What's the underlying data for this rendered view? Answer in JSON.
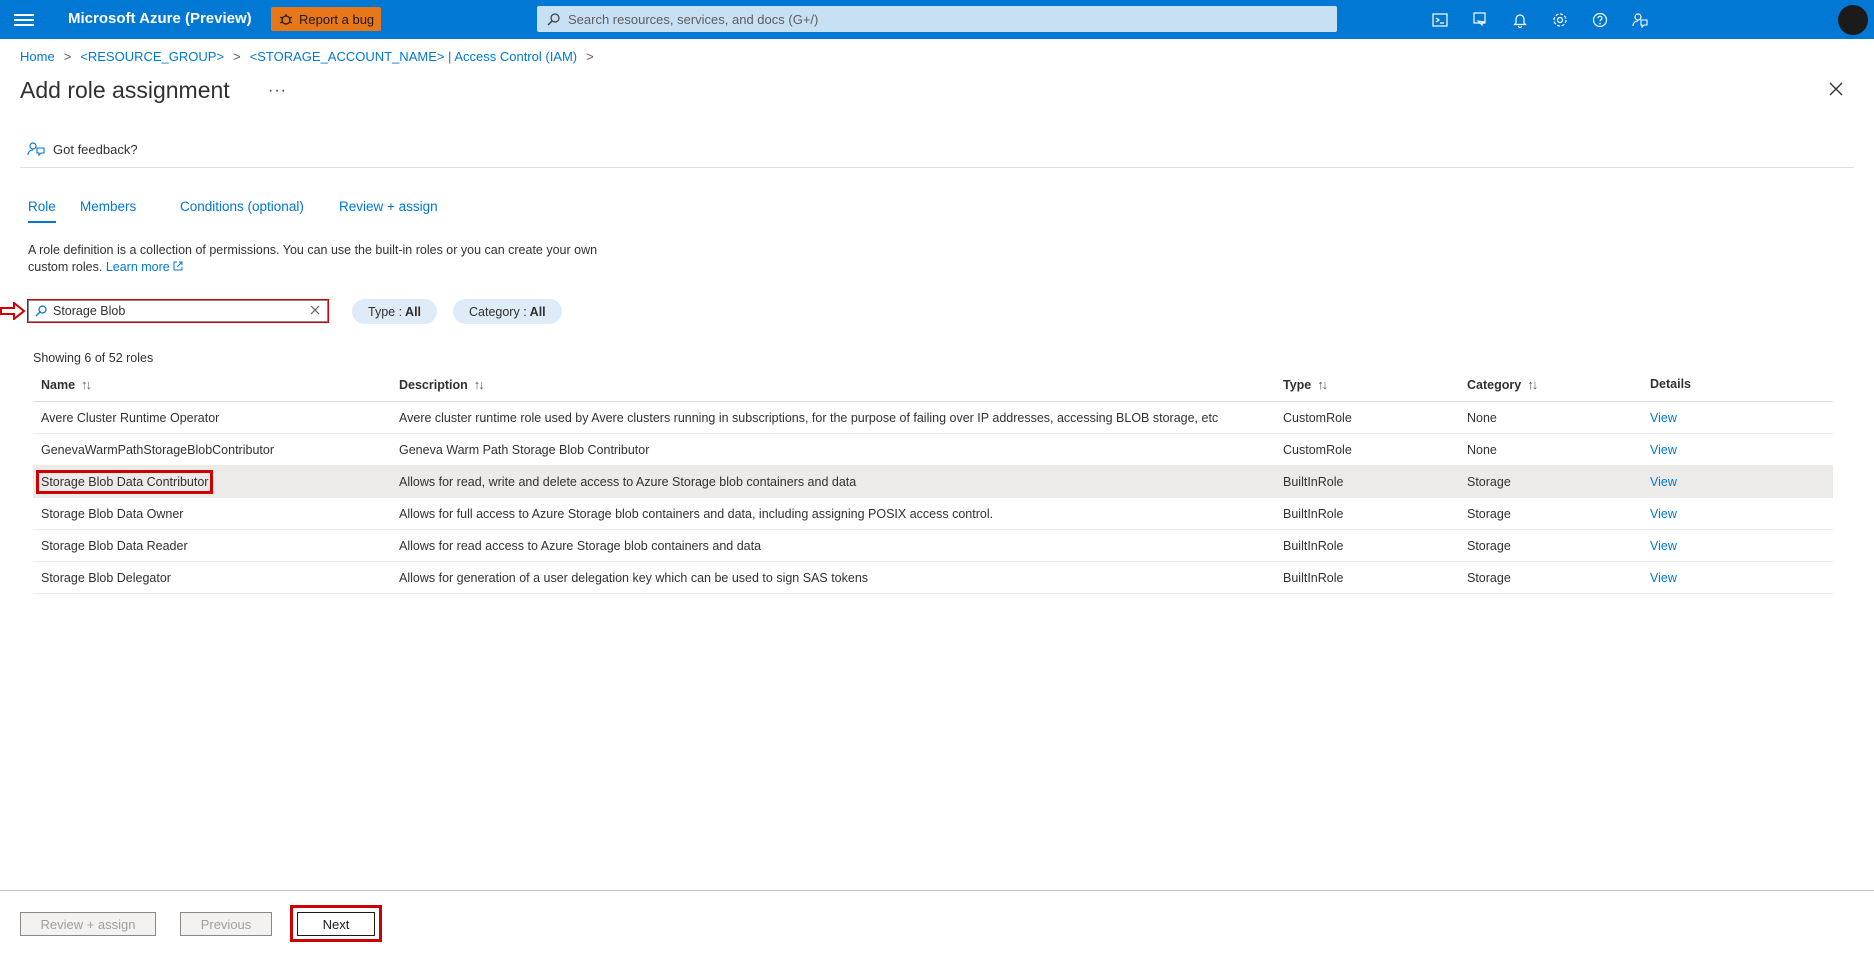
{
  "topbar": {
    "brand": "Microsoft Azure (Preview)",
    "report_bug": "Report a bug",
    "search_placeholder": "Search resources, services, and docs (G+/)",
    "icons": [
      "cloud-shell-icon",
      "directory-filter-icon",
      "notifications-icon",
      "settings-icon",
      "help-icon",
      "feedback-icon"
    ]
  },
  "breadcrumb": {
    "items": [
      "Home",
      "<RESOURCE_GROUP>",
      "<STORAGE_ACCOUNT_NAME> | Access Control (IAM)"
    ]
  },
  "page": {
    "title": "Add role assignment",
    "more": "···",
    "feedback": "Got feedback?"
  },
  "tabs": [
    "Role",
    "Members",
    "Conditions (optional)",
    "Review + assign"
  ],
  "intro": {
    "text": "A role definition is a collection of permissions. You can use the built-in roles or you can create your own custom roles.",
    "learn_more": "Learn more"
  },
  "filters": {
    "search_value": "Storage Blob",
    "type_label": "Type : ",
    "type_value": "All",
    "category_label": "Category : ",
    "category_value": "All"
  },
  "table": {
    "showing": "Showing 6 of 52 roles",
    "headers": [
      "Name",
      "Description",
      "Type",
      "Category",
      "Details"
    ],
    "rows": [
      {
        "name": "Avere Cluster Runtime Operator",
        "description": "Avere cluster runtime role used by Avere clusters running in subscriptions, for the purpose of failing over IP addresses, accessing BLOB storage, etc",
        "type": "CustomRole",
        "category": "None",
        "details": "View"
      },
      {
        "name": "GenevaWarmPathStorageBlobContributor",
        "description": "Geneva Warm Path Storage Blob Contributor",
        "type": "CustomRole",
        "category": "None",
        "details": "View"
      },
      {
        "name": "Storage Blob Data Contributor",
        "description": "Allows for read, write and delete access to Azure Storage blob containers and data",
        "type": "BuiltInRole",
        "category": "Storage",
        "details": "View"
      },
      {
        "name": "Storage Blob Data Owner",
        "description": "Allows for full access to Azure Storage blob containers and data, including assigning POSIX access control.",
        "type": "BuiltInRole",
        "category": "Storage",
        "details": "View"
      },
      {
        "name": "Storage Blob Data Reader",
        "description": "Allows for read access to Azure Storage blob containers and data",
        "type": "BuiltInRole",
        "category": "Storage",
        "details": "View"
      },
      {
        "name": "Storage Blob Delegator",
        "description": "Allows for generation of a user delegation key which can be used to sign SAS tokens",
        "type": "BuiltInRole",
        "category": "Storage",
        "details": "View"
      }
    ]
  },
  "footer": {
    "review": "Review + assign",
    "previous": "Previous",
    "next": "Next"
  },
  "colors": {
    "accent": "#0078d4",
    "highlight": "#d00000",
    "bug_button": "#e8771a"
  }
}
